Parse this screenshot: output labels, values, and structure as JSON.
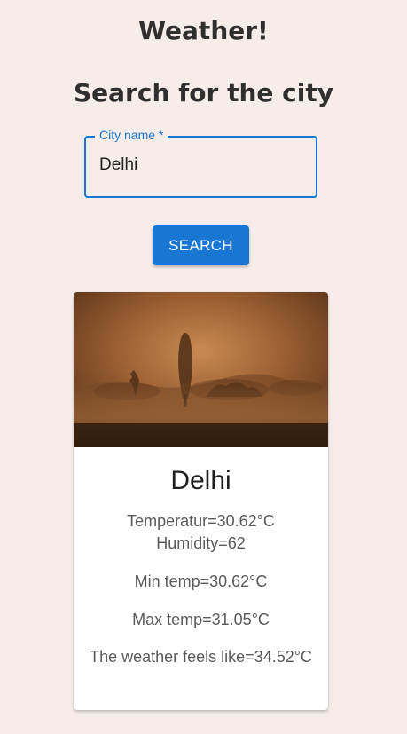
{
  "header": {
    "app_title": "Weather!",
    "search_heading": "Search for the city"
  },
  "search": {
    "label": "City name *",
    "value": "Delhi",
    "button_label": "SEARCH"
  },
  "result": {
    "city": "Delhi",
    "temperature": "Temperatur=30.62°C",
    "humidity": "Humidity=62",
    "min_temp": "Min temp=30.62°C",
    "max_temp": "Max temp=31.05°C",
    "feels_like": "The weather feels like=34.52°C"
  },
  "colors": {
    "background": "#f6edeb",
    "accent": "#1976d2",
    "card": "#ffffff"
  }
}
